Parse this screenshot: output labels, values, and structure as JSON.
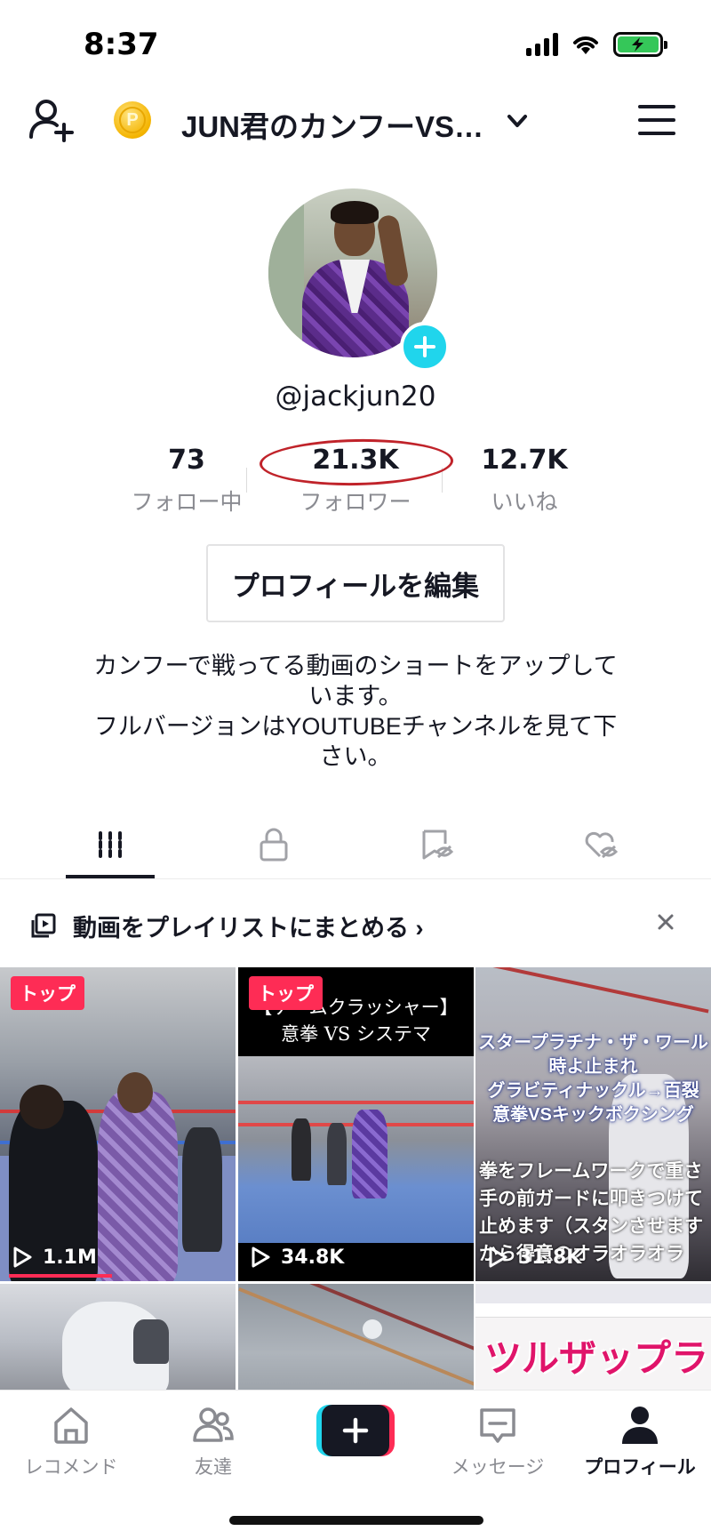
{
  "status_bar": {
    "time": "8:37"
  },
  "header": {
    "account_title": "JUN君のカンフーVS…",
    "coin_letter": "P"
  },
  "profile": {
    "username": "@jackjun20",
    "stats": [
      {
        "value": "73",
        "label": "フォロー中"
      },
      {
        "value": "21.3K",
        "label": "フォロワー"
      },
      {
        "value": "12.7K",
        "label": "いいね"
      }
    ],
    "edit_button": "プロフィールを編集",
    "bio_lines": [
      "カンフーで戦ってる動画のショートをアップして",
      "います。",
      "フルバージョンはYOUTUBEチャンネルを見て下",
      "さい。"
    ]
  },
  "tabs": [
    {
      "name": "videos",
      "icon": "grid-icon",
      "active": true
    },
    {
      "name": "private",
      "icon": "lock-icon",
      "active": false
    },
    {
      "name": "favorites",
      "icon": "bookmark-hidden-icon",
      "active": false
    },
    {
      "name": "liked",
      "icon": "heart-hidden-icon",
      "active": false
    }
  ],
  "playlist_bar": {
    "text": "動画をプレイリストにまとめる ›"
  },
  "videos": [
    {
      "badge": "トップ",
      "views": "1.1M",
      "caption": ""
    },
    {
      "badge": "トップ",
      "views": "34.8K",
      "caption_lines": [
        "【ゲームクラッシャー】",
        "意拳 VS システマ"
      ]
    },
    {
      "badge": "",
      "views": "31.8K",
      "caption_lines": [
        "スタープラチナ・ザ・ワール",
        "時よ止まれ",
        "グラビティナックル→百裂",
        "意拳VSキックボクシング"
      ],
      "subtitle_lines": [
        "拳をフレームワークで重さ",
        "手の前ガードに叩きつけて",
        "止めます（スタンさせます",
        "から得意のオラオラオラ"
      ]
    },
    {
      "badge": "",
      "views": "",
      "caption": ""
    },
    {
      "badge": "",
      "views": "",
      "caption": ""
    },
    {
      "badge": "",
      "views": "",
      "banner": "ツルザップラ"
    }
  ],
  "bottom_nav": {
    "home": "レコメンド",
    "friends": "友達",
    "inbox": "メッセージ",
    "profile": "プロフィール"
  },
  "colors": {
    "accent_red": "#fe2c55",
    "accent_cyan": "#20d5ec",
    "annotation": "#c0232a",
    "battery_green": "#35c759"
  }
}
